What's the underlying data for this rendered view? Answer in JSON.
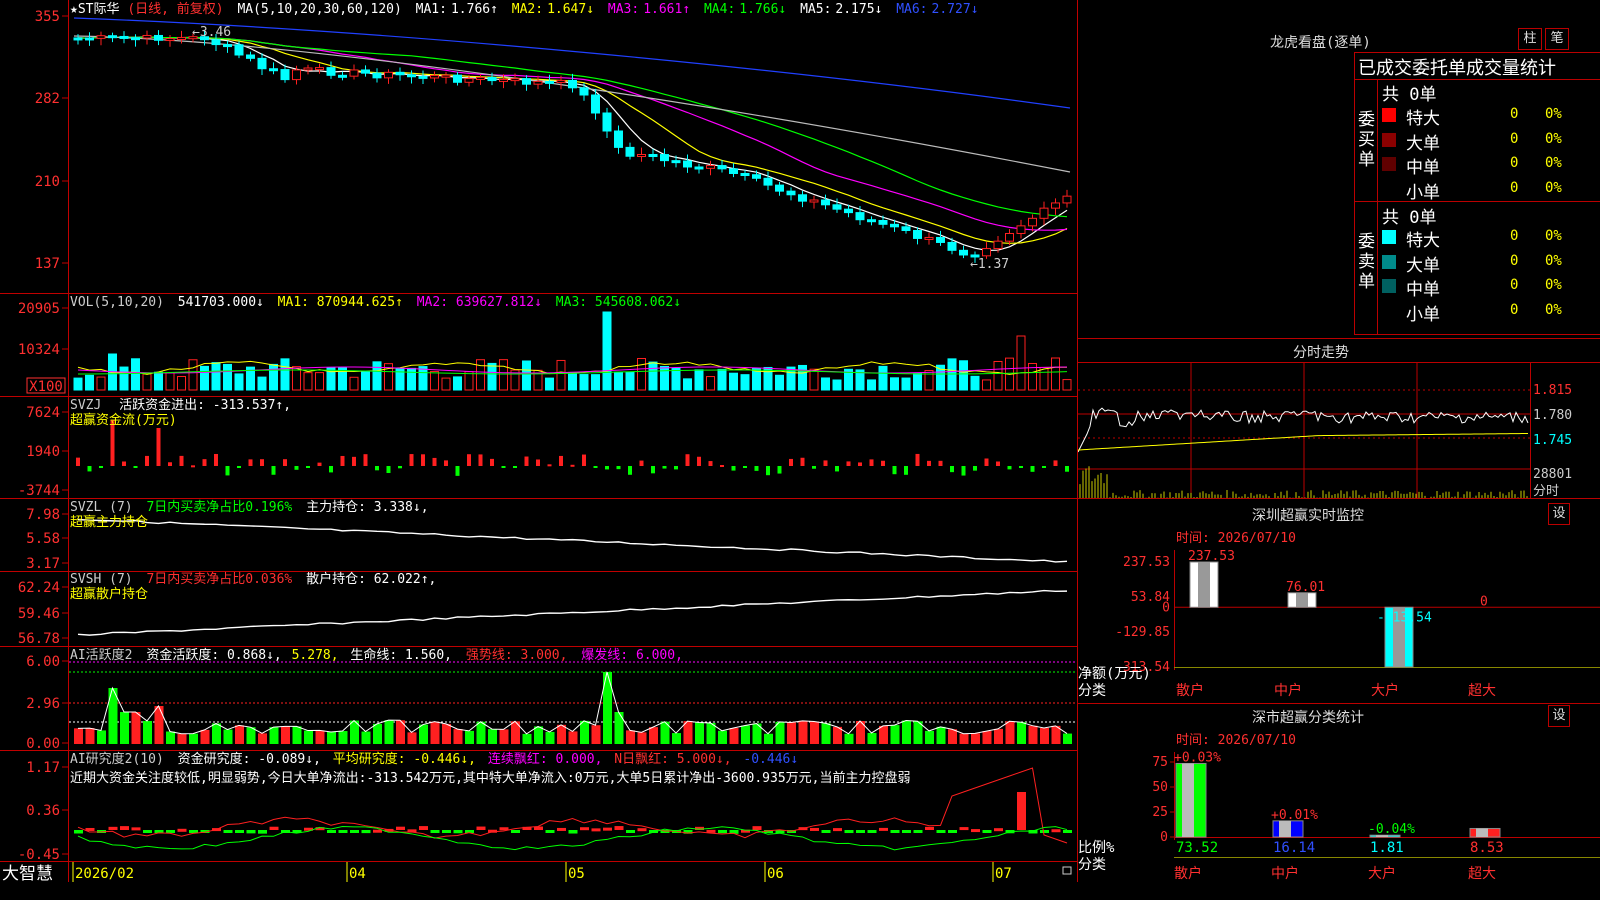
{
  "header": {
    "symbol": "★ST际华",
    "period": "(日线, 前复权)",
    "ma_label": "MA(5,10,20,30,60,120)",
    "ma_values": [
      {
        "name": "MA1:",
        "val": "1.766↑",
        "color": "#ffffff"
      },
      {
        "name": "MA2:",
        "val": "1.647↓",
        "color": "#ffff00"
      },
      {
        "name": "MA3:",
        "val": "1.661↑",
        "color": "#ff00ff"
      },
      {
        "name": "MA4:",
        "val": "1.766↓",
        "color": "#00ff00"
      },
      {
        "name": "MA5:",
        "val": "2.175↓",
        "color": "#cccccc"
      },
      {
        "name": "MA6:",
        "val": "2.727↓",
        "color": "#3050ff"
      }
    ]
  },
  "price_panel": {
    "y_ticks": [
      "355",
      "282",
      "210",
      "137"
    ],
    "max_label": "←3.46",
    "min_label": "←1.37"
  },
  "vol_panel": {
    "title": "VOL(5,10,20)",
    "value": "541703.000↓",
    "ma1": "MA1: 870944.625↑",
    "ma2": "MA2: 639627.812↓",
    "ma3": "MA3: 545608.062↓",
    "y_ticks": [
      "20905",
      "10324"
    ],
    "unit": "X100"
  },
  "svzj_panel": {
    "title": "SVZJ",
    "line1": "活跃资金进出: -313.537↑,",
    "line2": "超赢资金流(万元)",
    "y_ticks": [
      "7624",
      "1940",
      "-3744"
    ]
  },
  "svzl_panel": {
    "title": "SVZL (7)",
    "line1a": "7日内买卖净占比0.196%",
    "line1b": "主力持仓: 3.338↓,",
    "line2": "超赢主力持仓",
    "y_ticks": [
      "7.98",
      "5.58",
      "3.17"
    ]
  },
  "svsh_panel": {
    "title": "SVSH (7)",
    "line1a": "7日内买卖净占比0.036%",
    "line1b": "散户持仓: 62.022↑,",
    "line2": "超赢散户持仓",
    "y_ticks": [
      "62.24",
      "59.46",
      "56.78"
    ]
  },
  "ai_active_panel": {
    "title": "AI活跃度2",
    "t1": "资金活跃度: 0.868↓,",
    "t2": "5.278,",
    "t3": "生命线: 1.560,",
    "t4": "强势线: 3.000,",
    "t5": "爆发线: 6.000,",
    "y_ticks": [
      "6.00",
      "2.96",
      "0.00"
    ]
  },
  "ai_research_panel": {
    "title": "AI研究度2(10)",
    "t1": "资金研究度: -0.089↓,",
    "t2": "平均研究度: -0.446↓,",
    "t3": "连续飘红: 0.000,",
    "t4": "N日飘红: 5.000↓,",
    "t5": "-0.446↓",
    "comment": "近期大资金关注度较低,明显弱势,今日大单净流出:-313.542万元,其中特大单净流入:0万元,大单5日累计净出-3600.935万元,当前主力控盘弱",
    "y_ticks": [
      "1.17",
      "0.36",
      "-0.45"
    ]
  },
  "x_axis": {
    "brand": "大智慧",
    "labels": [
      "2026/02",
      "04",
      "05",
      "06",
      "07"
    ]
  },
  "dragon_tiger": {
    "title": "龙虎看盘(逐单)",
    "btn_bar": "柱",
    "btn_pen": "笔",
    "subtitle": "已成交委托单成交量统计",
    "buy": {
      "side_label": "委买单",
      "total": "共 0单",
      "rows": [
        {
          "name": "特大",
          "qty": "0",
          "pct": "0%",
          "color": "#ff0000"
        },
        {
          "name": "大单",
          "qty": "0",
          "pct": "0%",
          "color": "#8b0000"
        },
        {
          "name": "中单",
          "qty": "0",
          "pct": "0%",
          "color": "#600000"
        },
        {
          "name": "小单",
          "qty": "0",
          "pct": "0%",
          "color": "#000000"
        }
      ]
    },
    "sell": {
      "side_label": "委卖单",
      "total": "共 0单",
      "rows": [
        {
          "name": "特大",
          "qty": "0",
          "pct": "0%",
          "color": "#00ffff"
        },
        {
          "name": "大单",
          "qty": "0",
          "pct": "0%",
          "color": "#008b8b"
        },
        {
          "name": "中单",
          "qty": "0",
          "pct": "0%",
          "color": "#006060"
        },
        {
          "name": "小单",
          "qty": "0",
          "pct": "0%",
          "color": "#000000"
        }
      ]
    }
  },
  "intraday": {
    "title": "分时走势",
    "price_ticks": [
      "1.815",
      "1.780",
      "1.745"
    ],
    "vol_tick": "28801",
    "x_label": "分时"
  },
  "sz_monitor": {
    "title": "深圳超赢实时监控",
    "btn": "设",
    "time": "时间: 2026/07/10",
    "y_ticks": [
      "237.53",
      "53.84",
      "0",
      "-129.85",
      "-313.54"
    ],
    "y_caption": "净额(万元)",
    "x_caption": "分类",
    "categories": [
      "散户",
      "中户",
      "大户",
      "超大"
    ],
    "values": [
      237.53,
      76.01,
      -313.54,
      0
    ],
    "value_labels": [
      "237.53",
      "76.01",
      "-313.54",
      "0"
    ]
  },
  "sz_class": {
    "title": "深市超赢分类统计",
    "btn": "设",
    "time": "时间: 2026/07/10",
    "y_ticks": [
      "75",
      "50",
      "25",
      "0"
    ],
    "y_caption": "比例%",
    "x_caption": "分类",
    "categories": [
      "散户",
      "中户",
      "大户",
      "超大"
    ],
    "values": [
      73.52,
      16.14,
      1.81,
      8.53
    ],
    "value_labels": [
      "73.52",
      "16.14",
      "1.81",
      "8.53"
    ],
    "change_labels": [
      "+0.03%",
      "+0.01%",
      "-0.04%",
      ""
    ]
  },
  "chart_data": [
    {
      "type": "bar",
      "title": "深圳超赢实时监控",
      "ylabel": "净额(万元)",
      "categories": [
        "散户",
        "中户",
        "大户",
        "超大"
      ],
      "values": [
        237.53,
        76.01,
        -313.54,
        0
      ],
      "ylim": [
        -313.54,
        237.53
      ]
    },
    {
      "type": "bar",
      "title": "深市超赢分类统计",
      "ylabel": "比例%",
      "categories": [
        "散户",
        "中户",
        "大户",
        "超大"
      ],
      "values": [
        73.52,
        16.14,
        1.81,
        8.53
      ],
      "ylim": [
        0,
        75
      ]
    }
  ]
}
